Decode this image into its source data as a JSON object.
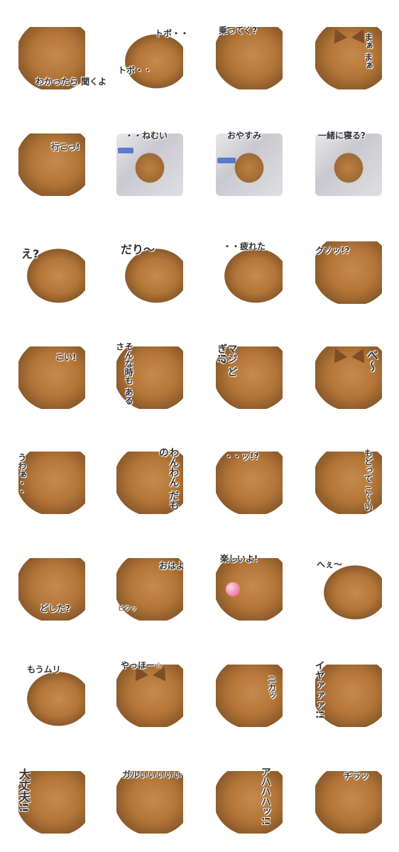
{
  "sheet": {
    "stickers": [
      {
        "caption": "わかったら 聞くよ"
      },
      {
        "caption": "トボ・・ トボ・・"
      },
      {
        "caption": "乗ってく?"
      },
      {
        "caption": "まぁ まぁ"
      },
      {
        "caption": "行こっ!"
      },
      {
        "caption": "・・ねむい"
      },
      {
        "caption": "おやすみ"
      },
      {
        "caption": "一緒に寝る?"
      },
      {
        "caption": "え?"
      },
      {
        "caption": "だり〜"
      },
      {
        "caption": "・・疲れた"
      },
      {
        "caption": "クソッ!?"
      },
      {
        "caption": "こい!"
      },
      {
        "caption": "そんな時も あるさ"
      },
      {
        "caption": "マジ どぎ!?"
      },
      {
        "caption": "べ〜"
      },
      {
        "caption": "うわぁ・・"
      },
      {
        "caption": "わんわん だもの"
      },
      {
        "caption": "・・ッ!?"
      },
      {
        "caption": "もどって こ〜い"
      },
      {
        "caption": "どした?"
      },
      {
        "caption": "おはよ"
      },
      {
        "caption": "楽しいよ!"
      },
      {
        "caption": "へぇ〜"
      },
      {
        "caption": "もうムリ"
      },
      {
        "caption": "やっほー☆"
      },
      {
        "caption": "ニカッ"
      },
      {
        "caption": "イヤァァァ!!"
      },
      {
        "caption": "大丈夫!!"
      },
      {
        "caption": "ガルぃぃぃぃぃ"
      },
      {
        "caption": "アハハハッ!!"
      },
      {
        "caption": "チラッ"
      }
    ],
    "extra_labels": {
      "sticker_1_second_caption": "トボ・・",
      "sticker_21_sfx": "ピクッ"
    }
  }
}
